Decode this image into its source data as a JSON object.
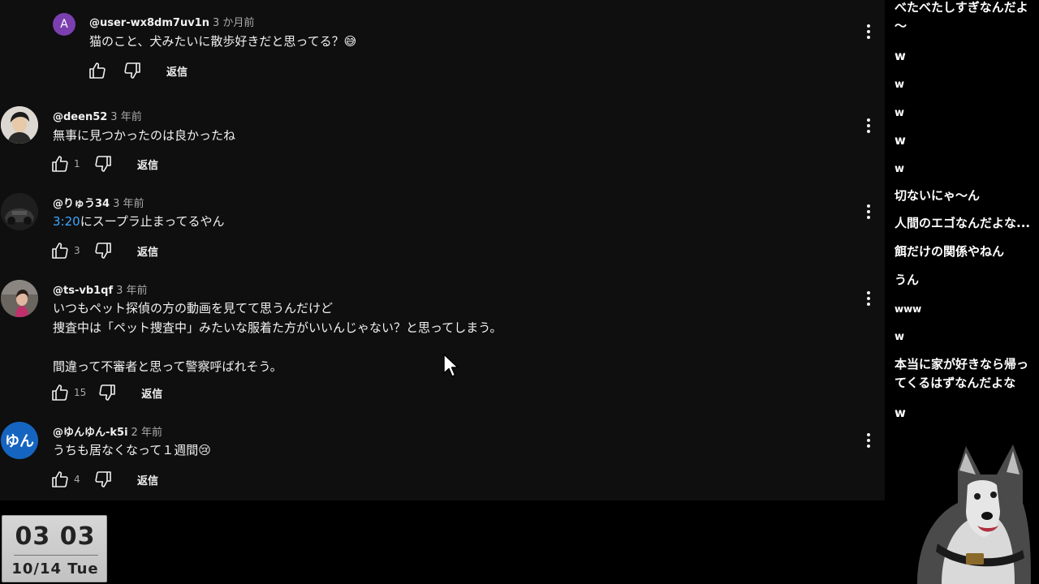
{
  "comments": [
    {
      "avatar_letter": "A",
      "avatar_color": "#7b3fb0",
      "handle": "@user-wx8dm7uv1n",
      "time": "3 か月前",
      "text": "猫のこと、犬みたいに散歩好きだと思ってる？😅",
      "likes": "",
      "reply_label": "返信"
    },
    {
      "handle": "@deen52",
      "time": "3 年前",
      "text": "無事に見つかったのは良かったね",
      "likes": "1",
      "reply_label": "返信"
    },
    {
      "handle": "@りゅう34",
      "time": "3 年前",
      "timestamp_link": "3:20",
      "text": "にスープラ止まってるやん",
      "likes": "3",
      "reply_label": "返信"
    },
    {
      "handle": "@ts-vb1qf",
      "time": "3 年前",
      "text": "いつもペット探偵の方の動画を見てて思うんだけど\n捜査中は「ペット捜査中」みたいな服着た方がいいんじゃない？と思ってしまう。\n\n間違って不審者と思って警察呼ばれそう。",
      "likes": "15",
      "reply_label": "返信"
    },
    {
      "avatar_text": "ゆん",
      "avatar_color": "#1565c0",
      "handle": "@ゆんゆん-k5i",
      "time": "2 年前",
      "text": "うちも居なくなって１週間😢",
      "likes": "4",
      "reply_label": "返信"
    }
  ],
  "clock": {
    "time": "03 03",
    "date": "10/14 Tue"
  },
  "chat": [
    "べたべたしすぎなんだよ\n〜",
    "w",
    "w",
    "w",
    "w",
    "w",
    "切ないにゃ〜ん",
    "人間のエゴなんだよな...",
    "餌だけの関係やねん",
    "うん",
    "www",
    "w",
    "本当に家が好きなら帰っ\nてくるはずなんだよな",
    "w"
  ]
}
